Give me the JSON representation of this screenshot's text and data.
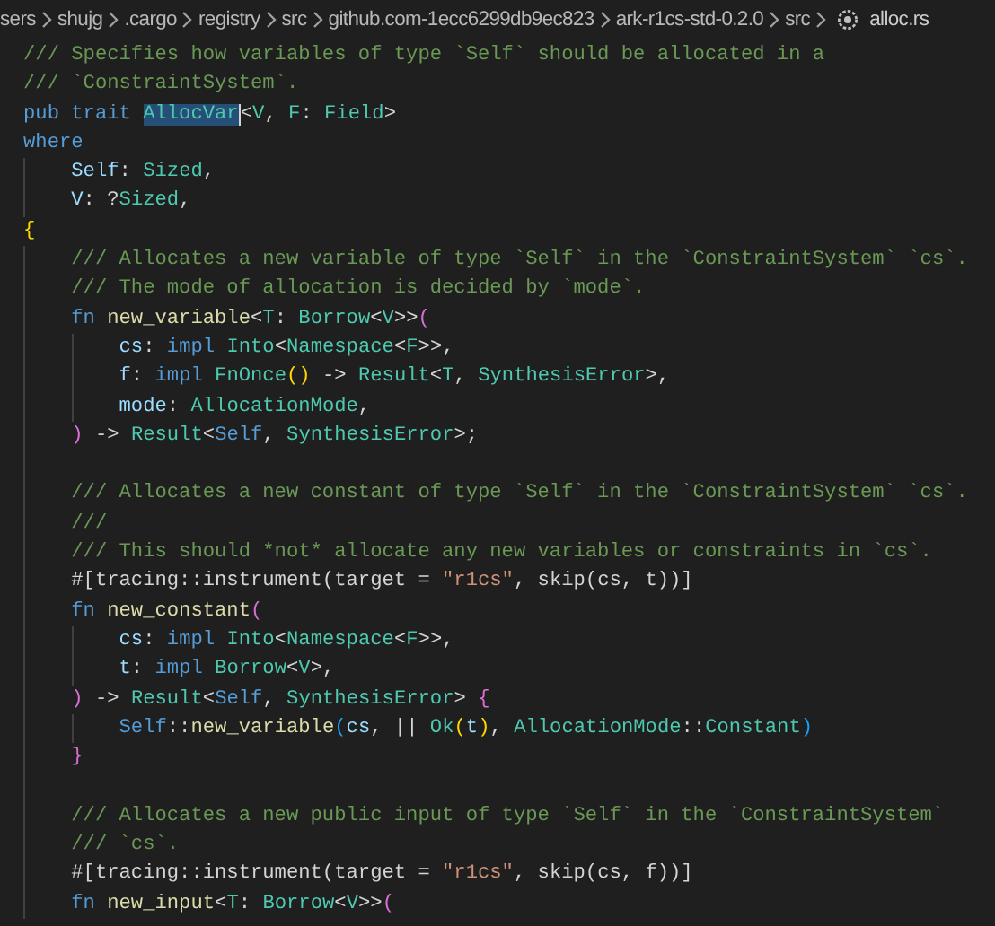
{
  "breadcrumb": [
    {
      "label": "sers",
      "kind": "folder"
    },
    {
      "label": "shujg",
      "kind": "folder"
    },
    {
      "label": ".cargo",
      "kind": "folder"
    },
    {
      "label": "registry",
      "kind": "folder"
    },
    {
      "label": "src",
      "kind": "folder"
    },
    {
      "label": "github.com-1ecc6299db9ec823",
      "kind": "folder"
    },
    {
      "label": "ark-r1cs-std-0.2.0",
      "kind": "folder"
    },
    {
      "label": "src",
      "kind": "folder"
    },
    {
      "label": "alloc.rs",
      "kind": "file"
    }
  ],
  "lines": [
    [
      {
        "text": "/// Specifies how variables of type `Self` should be allocated in a",
        "kind": "comment"
      }
    ],
    [
      {
        "text": "/// `ConstraintSystem`.",
        "kind": "comment"
      }
    ],
    [
      {
        "text": "pub trait ",
        "kind": "keyword"
      },
      {
        "text": "AllocVar",
        "kind": "selection"
      },
      {
        "text": "<",
        "kind": "plain"
      },
      {
        "text": "V",
        "kind": "type"
      },
      {
        "text": ", ",
        "kind": "plain"
      },
      {
        "text": "F",
        "kind": "type"
      },
      {
        "text": ": ",
        "kind": "plain"
      },
      {
        "text": "Field",
        "kind": "type"
      },
      {
        "text": ">",
        "kind": "plain"
      }
    ],
    [
      {
        "text": "where",
        "kind": "keyword"
      }
    ],
    [
      {
        "text": "    Self",
        "kind": "param"
      },
      {
        "text": ": ",
        "kind": "plain"
      },
      {
        "text": "Sized",
        "kind": "type"
      },
      {
        "text": ",",
        "kind": "plain"
      }
    ],
    [
      {
        "text": "    V",
        "kind": "param"
      },
      {
        "text": ": ?",
        "kind": "plain"
      },
      {
        "text": "Sized",
        "kind": "type"
      },
      {
        "text": ",",
        "kind": "plain"
      }
    ],
    [
      {
        "text": "{",
        "kind": "bracket1"
      }
    ],
    [
      {
        "text": "    /// Allocates a new variable of type `Self` in the `ConstraintSystem` `cs`.",
        "kind": "comment"
      }
    ],
    [
      {
        "text": "    /// The mode of allocation is decided by `mode`.",
        "kind": "comment"
      }
    ],
    [
      {
        "text": "    fn ",
        "kind": "keyword"
      },
      {
        "text": "new_variable",
        "kind": "function"
      },
      {
        "text": "<",
        "kind": "plain"
      },
      {
        "text": "T",
        "kind": "type"
      },
      {
        "text": ": ",
        "kind": "plain"
      },
      {
        "text": "Borrow",
        "kind": "type"
      },
      {
        "text": "<",
        "kind": "plain"
      },
      {
        "text": "V",
        "kind": "type"
      },
      {
        "text": ">>",
        "kind": "plain"
      },
      {
        "text": "(",
        "kind": "bracket2"
      }
    ],
    [
      {
        "text": "        cs",
        "kind": "param"
      },
      {
        "text": ": ",
        "kind": "plain"
      },
      {
        "text": "impl ",
        "kind": "keyword"
      },
      {
        "text": "Into",
        "kind": "type"
      },
      {
        "text": "<",
        "kind": "plain"
      },
      {
        "text": "Namespace",
        "kind": "type"
      },
      {
        "text": "<",
        "kind": "plain"
      },
      {
        "text": "F",
        "kind": "type"
      },
      {
        "text": ">>,",
        "kind": "plain"
      }
    ],
    [
      {
        "text": "        f",
        "kind": "param"
      },
      {
        "text": ": ",
        "kind": "plain"
      },
      {
        "text": "impl ",
        "kind": "keyword"
      },
      {
        "text": "FnOnce",
        "kind": "type"
      },
      {
        "text": "()",
        "kind": "bracket1"
      },
      {
        "text": " -> ",
        "kind": "plain"
      },
      {
        "text": "Result",
        "kind": "type"
      },
      {
        "text": "<",
        "kind": "plain"
      },
      {
        "text": "T",
        "kind": "type"
      },
      {
        "text": ", ",
        "kind": "plain"
      },
      {
        "text": "SynthesisError",
        "kind": "type"
      },
      {
        "text": ">,",
        "kind": "plain"
      }
    ],
    [
      {
        "text": "        mode",
        "kind": "param"
      },
      {
        "text": ": ",
        "kind": "plain"
      },
      {
        "text": "AllocationMode",
        "kind": "type"
      },
      {
        "text": ",",
        "kind": "plain"
      }
    ],
    [
      {
        "text": "    )",
        "kind": "bracket2"
      },
      {
        "text": " -> ",
        "kind": "plain"
      },
      {
        "text": "Result",
        "kind": "type"
      },
      {
        "text": "<",
        "kind": "plain"
      },
      {
        "text": "Self",
        "kind": "keyword"
      },
      {
        "text": ", ",
        "kind": "plain"
      },
      {
        "text": "SynthesisError",
        "kind": "type"
      },
      {
        "text": ">;",
        "kind": "plain"
      }
    ],
    {
      "kind": "blank"
    },
    [
      {
        "text": "    /// Allocates a new constant of type `Self` in the `ConstraintSystem` `cs`.",
        "kind": "comment"
      }
    ],
    [
      {
        "text": "    ///",
        "kind": "comment"
      }
    ],
    [
      {
        "text": "    /// This should *not* allocate any new variables or constraints in `cs`.",
        "kind": "comment"
      }
    ],
    [
      {
        "text": "    #[tracing::instrument(target = ",
        "kind": "plain"
      },
      {
        "text": "\"r1cs\"",
        "kind": "string"
      },
      {
        "text": ", skip(cs, t))]",
        "kind": "plain"
      }
    ],
    [
      {
        "text": "    fn ",
        "kind": "keyword"
      },
      {
        "text": "new_constant",
        "kind": "function"
      },
      {
        "text": "(",
        "kind": "bracket2"
      }
    ],
    [
      {
        "text": "        cs",
        "kind": "param"
      },
      {
        "text": ": ",
        "kind": "plain"
      },
      {
        "text": "impl ",
        "kind": "keyword"
      },
      {
        "text": "Into",
        "kind": "type"
      },
      {
        "text": "<",
        "kind": "plain"
      },
      {
        "text": "Namespace",
        "kind": "type"
      },
      {
        "text": "<",
        "kind": "plain"
      },
      {
        "text": "F",
        "kind": "type"
      },
      {
        "text": ">>,",
        "kind": "plain"
      }
    ],
    [
      {
        "text": "        t",
        "kind": "param"
      },
      {
        "text": ": ",
        "kind": "plain"
      },
      {
        "text": "impl ",
        "kind": "keyword"
      },
      {
        "text": "Borrow",
        "kind": "type"
      },
      {
        "text": "<",
        "kind": "plain"
      },
      {
        "text": "V",
        "kind": "type"
      },
      {
        "text": ">,",
        "kind": "plain"
      }
    ],
    [
      {
        "text": "    )",
        "kind": "bracket2"
      },
      {
        "text": " -> ",
        "kind": "plain"
      },
      {
        "text": "Result",
        "kind": "type"
      },
      {
        "text": "<",
        "kind": "plain"
      },
      {
        "text": "Self",
        "kind": "keyword"
      },
      {
        "text": ", ",
        "kind": "plain"
      },
      {
        "text": "SynthesisError",
        "kind": "type"
      },
      {
        "text": "> ",
        "kind": "plain"
      },
      {
        "text": "{",
        "kind": "bracket2"
      }
    ],
    [
      {
        "text": "        Self",
        "kind": "keyword"
      },
      {
        "text": "::",
        "kind": "plain"
      },
      {
        "text": "new_variable",
        "kind": "function"
      },
      {
        "text": "(",
        "kind": "bracket3"
      },
      {
        "text": "cs",
        "kind": "param"
      },
      {
        "text": ", || ",
        "kind": "plain"
      },
      {
        "text": "Ok",
        "kind": "type"
      },
      {
        "text": "(",
        "kind": "bracket1"
      },
      {
        "text": "t",
        "kind": "param"
      },
      {
        "text": ")",
        "kind": "bracket1"
      },
      {
        "text": ", ",
        "kind": "plain"
      },
      {
        "text": "AllocationMode",
        "kind": "type"
      },
      {
        "text": "::",
        "kind": "plain"
      },
      {
        "text": "Constant",
        "kind": "type"
      },
      {
        "text": ")",
        "kind": "bracket3"
      }
    ],
    [
      {
        "text": "    }",
        "kind": "bracket2"
      }
    ],
    {
      "kind": "blank"
    },
    [
      {
        "text": "    /// Allocates a new public input of type `Self` in the `ConstraintSystem`",
        "kind": "comment"
      }
    ],
    [
      {
        "text": "    /// `cs`.",
        "kind": "comment"
      }
    ],
    [
      {
        "text": "    #[tracing::instrument(target = ",
        "kind": "plain"
      },
      {
        "text": "\"r1cs\"",
        "kind": "string"
      },
      {
        "text": ", skip(cs, f))]",
        "kind": "plain"
      }
    ],
    [
      {
        "text": "    fn ",
        "kind": "keyword"
      },
      {
        "text": "new_input",
        "kind": "function"
      },
      {
        "text": "<",
        "kind": "plain"
      },
      {
        "text": "T",
        "kind": "type"
      },
      {
        "text": ": ",
        "kind": "plain"
      },
      {
        "text": "Borrow",
        "kind": "type"
      },
      {
        "text": "<",
        "kind": "plain"
      },
      {
        "text": "V",
        "kind": "type"
      },
      {
        "text": ">>",
        "kind": "plain"
      },
      {
        "text": "(",
        "kind": "bracket2"
      }
    ]
  ]
}
